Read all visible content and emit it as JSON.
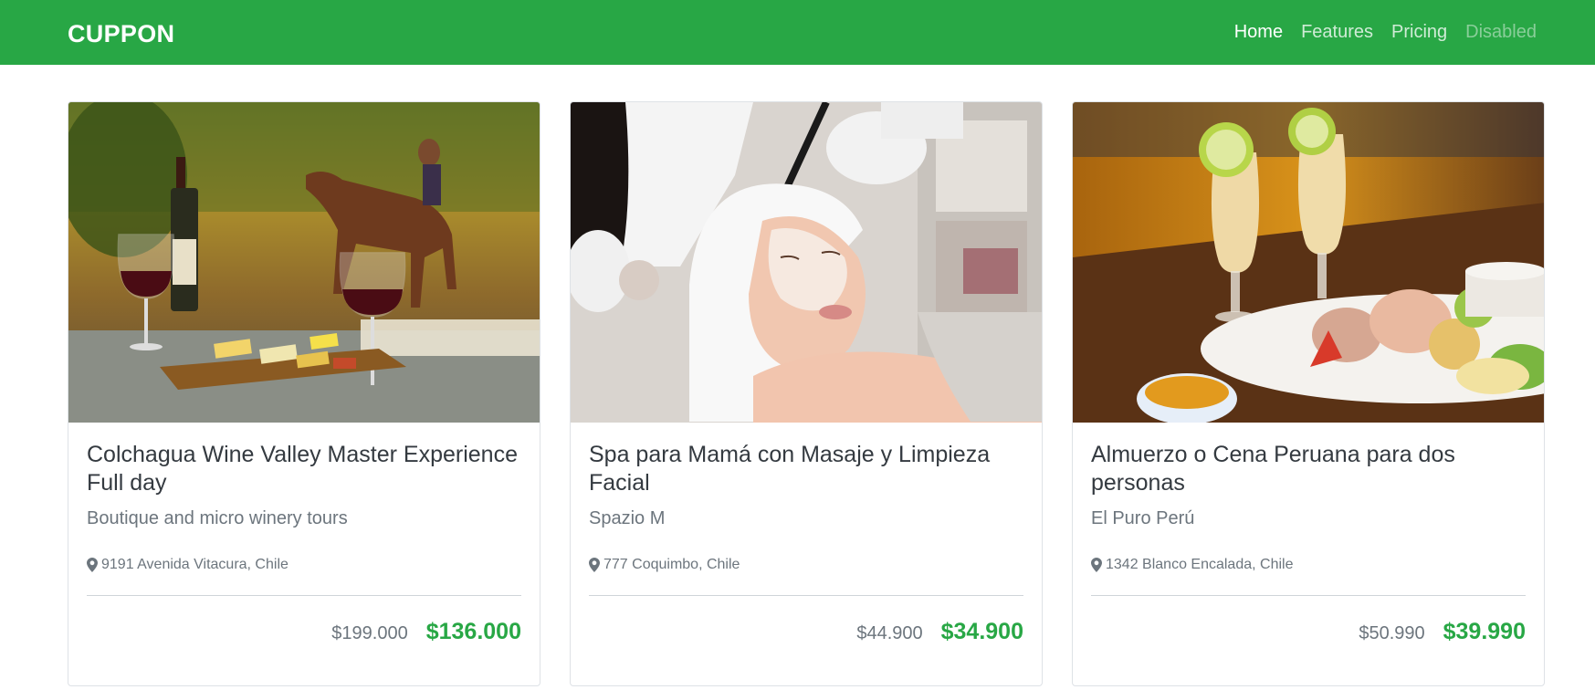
{
  "navbar": {
    "brand": "CUPPON",
    "links": [
      {
        "label": "Home"
      },
      {
        "label": "Features"
      },
      {
        "label": "Pricing"
      },
      {
        "label": "Disabled"
      }
    ],
    "color": "#28a745"
  },
  "cards": [
    {
      "title": "Colchagua Wine Valley Master Experience Full day",
      "subtitle": "Boutique and micro winery tours",
      "address": "9191 Avenida Vitacura, Chile",
      "old_price": "$199.000",
      "new_price": "$136.000",
      "image": "wine-horse-photo"
    },
    {
      "title": "Spa para Mamá con Masaje y Limpieza Facial",
      "subtitle": "Spazio M",
      "address": "777 Coquimbo, Chile",
      "old_price": "$44.900",
      "new_price": "$34.900",
      "image": "spa-facial-photo"
    },
    {
      "title": "Almuerzo o Cena Peruana para dos personas",
      "subtitle": "El Puro Perú",
      "address": "1342 Blanco Encalada, Chile",
      "old_price": "$50.990",
      "new_price": "$39.990",
      "image": "peruvian-food-photo"
    }
  ]
}
